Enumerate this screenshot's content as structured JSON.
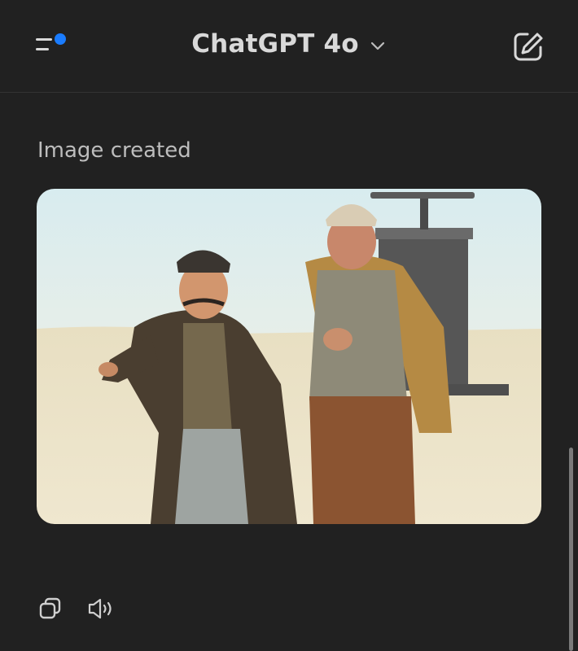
{
  "header": {
    "title": "ChatGPT 4o",
    "menu_icon": "sidebar-menu-icon",
    "notification_color": "#1a7cff",
    "new_chat_icon": "compose-icon"
  },
  "message": {
    "status": "Image created",
    "image_alt": "Two men in rustic costumes standing in a sunlit desert near an old stone tower"
  },
  "actions": {
    "copy_icon": "copy-icon",
    "read_aloud_icon": "speaker-icon"
  },
  "colors": {
    "background": "#212121",
    "text": "#ececec",
    "muted": "#bdbdbd",
    "accent": "#1a7cff"
  }
}
